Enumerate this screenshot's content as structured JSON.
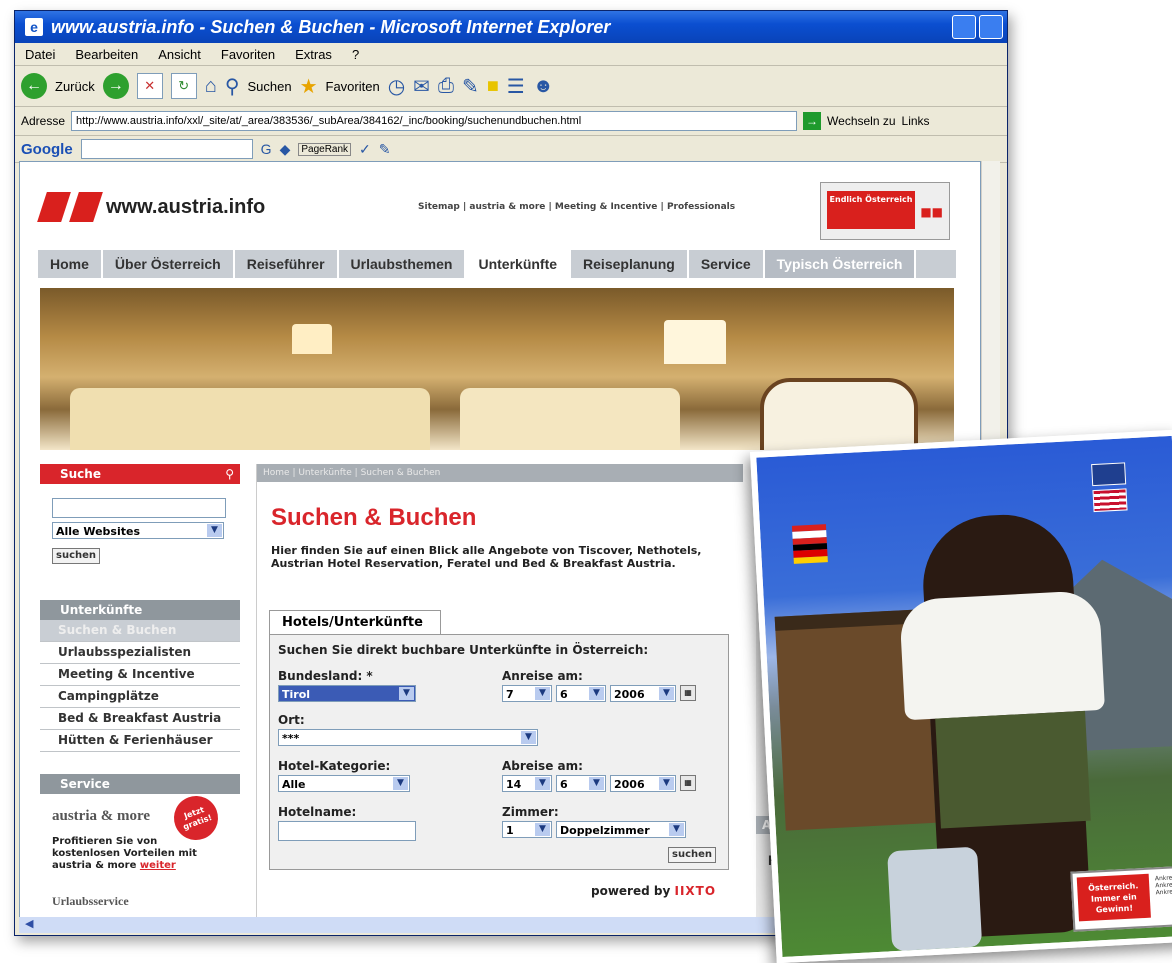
{
  "window": {
    "title": "www.austria.info - Suchen & Buchen - Microsoft Internet Explorer",
    "menu": [
      "Datei",
      "Bearbeiten",
      "Ansicht",
      "Favoriten",
      "Extras",
      "?"
    ],
    "toolbar": {
      "back": "Zurück",
      "search": "Suchen",
      "favorites": "Favoriten"
    },
    "address_label": "Adresse",
    "address_url": "http://www.austria.info/xxl/_site/at/_area/383536/_subArea/384162/_inc/booking/suchenundbuchen.html",
    "go_label": "Wechseln zu",
    "links_label": "Links",
    "google_label": "Google",
    "pagerank_label": "PageRank"
  },
  "site": {
    "logo_text": "www.austria.info",
    "top_links": "Sitemap | austria & more | Meeting & Incentive | Professionals",
    "badge_text": "Endlich Österreich",
    "nav": [
      "Home",
      "Über Österreich",
      "Reiseführer",
      "Urlaubsthemen",
      "Unterkünfte",
      "Reiseplanung",
      "Service",
      "Typisch Österreich"
    ]
  },
  "left": {
    "search_head": "Suche",
    "search_scope": "Alle Websites",
    "search_btn": "suchen",
    "accom_head": "Unterkünfte",
    "accom_sub": "Suchen & Buchen",
    "accom_items": [
      "Urlaubsspezialisten",
      "Meeting & Incentive",
      "Campingplätze",
      "Bed & Breakfast Austria",
      "Hütten & Ferienhäuser"
    ],
    "service_head": "Service",
    "promo_title": "austria & more",
    "promo_badge": "Jetzt gratis!",
    "promo_text": "Profitieren Sie von kostenlosen Vorteilen mit austria & more",
    "promo_link": "weiter",
    "urlaub_label": "Urlaubsservice"
  },
  "content": {
    "breadcrumb": "Home | Unterkünfte | Suchen & Buchen",
    "title": "Suchen & Buchen",
    "intro": "Hier finden Sie auf einen Blick alle Angebote von Tiscover, Nethotels, Austrian Hotel Reservation, Feratel und Bed & Breakfast Austria.",
    "tab": "Hotels/Unterkünfte",
    "form_intro": "Suchen Sie direkt buchbare Unterkünfte in Österreich:",
    "bundesland_label": "Bundesland: *",
    "bundesland_value": "Tirol",
    "anreise_label": "Anreise am:",
    "anreise": {
      "day": "7",
      "month": "6",
      "year": "2006"
    },
    "ort_label": "Ort:",
    "ort_value": "***",
    "kategorie_label": "Hotel-Kategorie:",
    "kategorie_value": "Alle",
    "abreise_label": "Abreise am:",
    "abreise": {
      "day": "14",
      "month": "6",
      "year": "2006"
    },
    "hotelname_label": "Hotelname:",
    "zimmer_label": "Zimmer:",
    "zimmer_count": "1",
    "zimmer_type": "Doppelzimmer",
    "submit": "suchen",
    "powered_by": "powered by",
    "powered_logo": "IIXTO"
  },
  "right": {
    "head2": "A",
    "ho": "Ho"
  },
  "overlay": {
    "badge_main": "Österreich. Immer ein Gewinn!",
    "badge_side": "Ankreuzen Ankreuzen Ankreuzen"
  },
  "colors": {
    "accent_red": "#d9252b",
    "nav_gray": "#c8cdd3",
    "title_bar": "#0b4fd1"
  }
}
